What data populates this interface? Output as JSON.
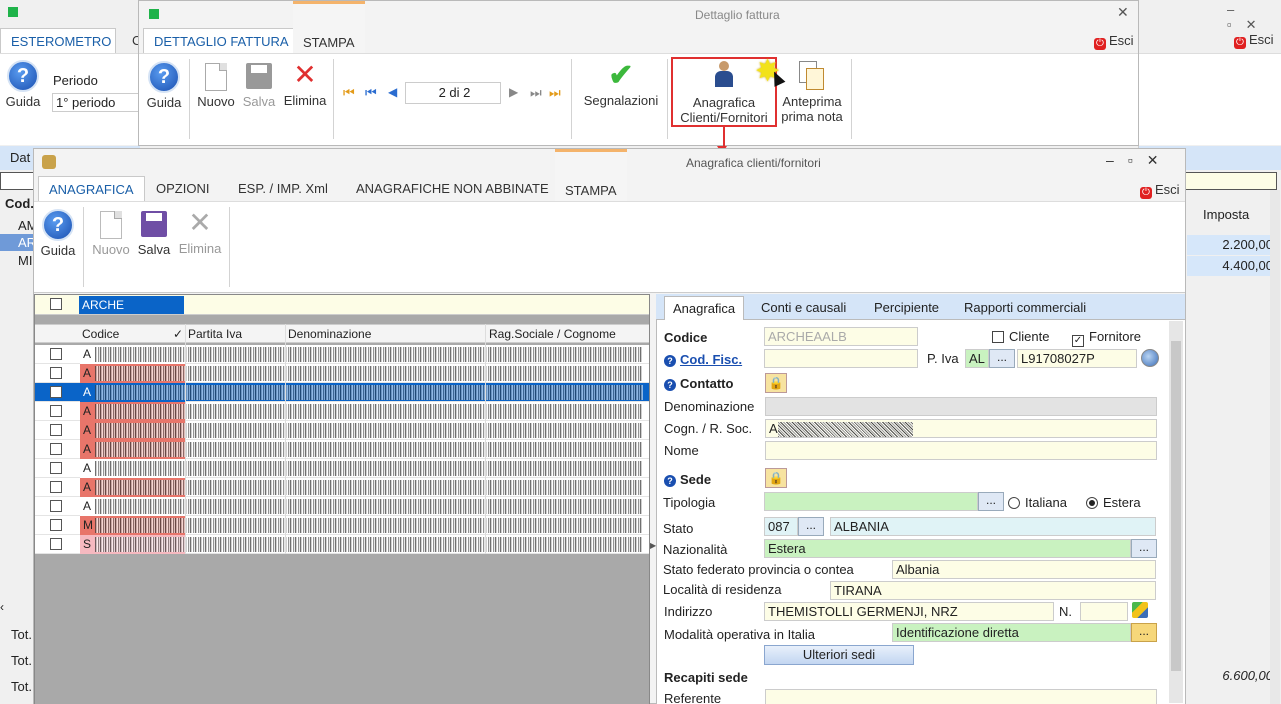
{
  "bg_window": {
    "tabs": [
      "ESTEROMETRO",
      "C"
    ],
    "periodo_label": "Periodo",
    "periodo_value": "1° periodo",
    "guida": "Guida",
    "esci": "Esci",
    "left_tree": {
      "header": "Dat",
      "col": "Cod.",
      "items": [
        "AM",
        "AR",
        "MI"
      ]
    },
    "right_table": {
      "header": "Imposta",
      "values": [
        "2.200,00",
        "4.400,00"
      ],
      "total": "6.600,00"
    },
    "tot_labels": [
      "Tot.",
      "Tot.",
      "Tot."
    ]
  },
  "fattura_window": {
    "title": "Dettaglio fattura",
    "tabs": [
      "DETTAGLIO FATTURA",
      "STAMPA"
    ],
    "esci": "Esci",
    "toolbar": {
      "guida": "Guida",
      "nuovo": "Nuovo",
      "salva": "Salva",
      "elimina": "Elimina",
      "nav_value": "2 di 2",
      "segnalazioni": "Segnalazioni",
      "anagrafica_line1": "Anagrafica",
      "anagrafica_line2": "Clienti/Fornitori",
      "anteprima_line1": "Anteprima",
      "anteprima_line2": "prima nota"
    }
  },
  "anagrafica_window": {
    "title": "Anagrafica clienti/fornitori",
    "tabs": [
      "ANAGRAFICA",
      "OPZIONI",
      "ESP. / IMP. Xml",
      "ANAGRAFICHE NON ABBINATE",
      "STAMPA"
    ],
    "esci": "Esci",
    "toolbar": {
      "guida": "Guida",
      "nuovo": "Nuovo",
      "salva": "Salva",
      "elimina": "Elimina"
    },
    "filter_value": "ARCHE",
    "list_headers": [
      "Codice",
      "✓",
      "Partita Iva",
      "Denominazione",
      "Rag.Sociale / Cognome"
    ],
    "list_rows": [
      {
        "code": "A",
        "color": "white"
      },
      {
        "code": "A",
        "color": "red"
      },
      {
        "code": "A",
        "color": "selected"
      },
      {
        "code": "A",
        "color": "red"
      },
      {
        "code": "A",
        "color": "red"
      },
      {
        "code": "A",
        "color": "red"
      },
      {
        "code": "A",
        "color": "white"
      },
      {
        "code": "A",
        "color": "red"
      },
      {
        "code": "A",
        "color": "white"
      },
      {
        "code": "M",
        "color": "red"
      },
      {
        "code": "S",
        "color": "pink"
      }
    ],
    "subtabs": [
      "Anagrafica",
      "Conti e causali",
      "Percipiente",
      "Rapporti commerciali"
    ],
    "form": {
      "codice_label": "Codice",
      "codice_value": "ARCHEAALB",
      "cliente_label": "Cliente",
      "fornitore_label": "Fornitore",
      "codfisc_label": "Cod. Fisc.",
      "piva_label": "P. Iva",
      "piva_country": "AL",
      "piva_value": "L91708027P",
      "contatto_label": "Contatto",
      "denominazione_label": "Denominazione",
      "cognome_label": "Cogn. / R. Soc.",
      "cognome_value": "A",
      "nome_label": "Nome",
      "sede_label": "Sede",
      "tipologia_label": "Tipologia",
      "italiana_label": "Italiana",
      "estera_label": "Estera",
      "stato_label": "Stato",
      "stato_code": "087",
      "stato_value": "ALBANIA",
      "nazionalita_label": "Nazionalità",
      "nazionalita_value": "Estera",
      "stato_federato_label": "Stato federato provincia o contea",
      "stato_federato_value": "Albania",
      "localita_label": "Località di residenza",
      "localita_value": "TIRANA",
      "indirizzo_label": "Indirizzo",
      "indirizzo_value": "THEMISTOLLI GERMENJI, NRZ",
      "numero_label": "N.",
      "modalita_label": "Modalità operativa in Italia",
      "modalita_value": "Identificazione diretta",
      "ulteriori_sedi": "Ulteriori sedi",
      "recapiti_label": "Recapiti sede",
      "referente_label": "Referente"
    }
  },
  "colors": {
    "accent": "#1a5fa8",
    "list_red": "#e8756a",
    "list_selected": "#0a64c8",
    "field_yellow": "#fdfde6",
    "field_green": "#c9f2c0"
  }
}
